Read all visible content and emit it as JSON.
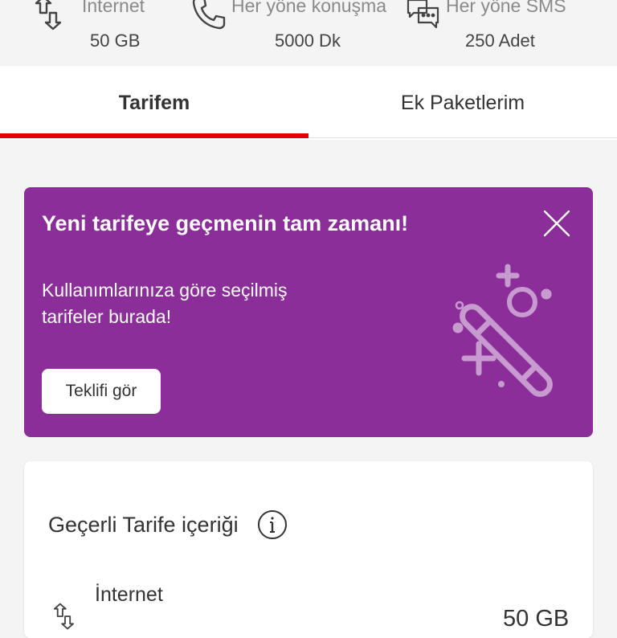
{
  "summary": [
    {
      "label": "İnternet",
      "value": "50 GB",
      "icon": "data-transfer-icon"
    },
    {
      "label": "Her yöne konuşma",
      "value": "5000 Dk",
      "icon": "phone-icon"
    },
    {
      "label": "Her yöne SMS",
      "value": "250 Adet",
      "icon": "message-icon"
    }
  ],
  "tabs": [
    {
      "label": "Tarifem",
      "active": true
    },
    {
      "label": "Ek Paketlerim",
      "active": false
    }
  ],
  "promo": {
    "title": "Yeni tarifeye geçmenin tam zamanı!",
    "text": "Kullanımlarınıza göre seçilmiş tarifeler burada!",
    "button": "Teklifi gör",
    "background": "#8b2e99"
  },
  "tariff": {
    "title": "Geçerli Tarife içeriği",
    "row_label": "İnternet",
    "row_value": "50 GB"
  },
  "colors": {
    "accent": "#e60000",
    "promo": "#8b2e99"
  }
}
